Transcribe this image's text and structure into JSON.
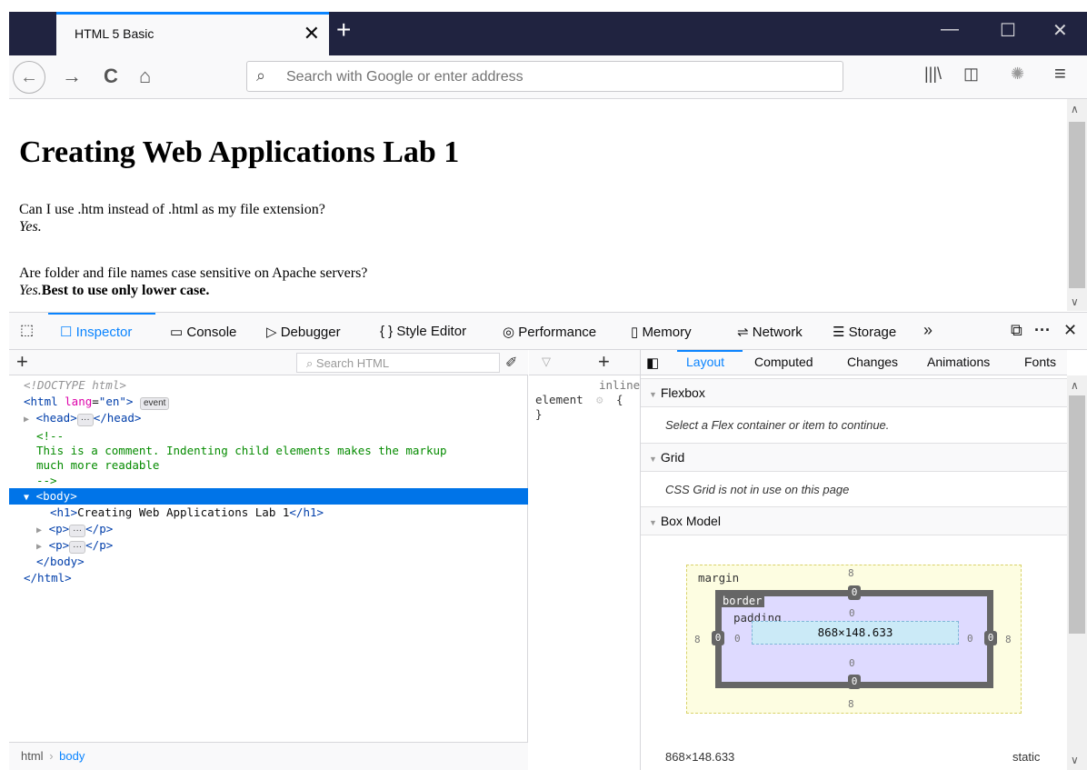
{
  "browser": {
    "tab_title": "HTML 5 Basic",
    "tab_close": "✕",
    "new_tab": "+",
    "window_controls": {
      "minimize": "—",
      "maximize": "☐",
      "close": "✕"
    },
    "nav": {
      "back": "←",
      "forward": "→",
      "reload": "C",
      "home": "⌂"
    },
    "url_placeholder": "Search with Google or enter address",
    "toolbar_icons": [
      "library-icon",
      "sidebar-icon",
      "addon-icon",
      "menu-icon"
    ],
    "library": "|||\\",
    "sidebar": "◫",
    "addon": "✺",
    "menu": "≡"
  },
  "page": {
    "heading": "Creating Web Applications Lab 1",
    "q1": "Can I use .htm instead of .html as my file extension?",
    "a1": "Yes.",
    "q2": "Are folder and file names case sensitive on Apache servers?",
    "a2_em": "Yes.",
    "a2_strong": "Best to use only lower case."
  },
  "devtools": {
    "tabs": [
      {
        "label": "Inspector",
        "icon": "☐"
      },
      {
        "label": "Console",
        "icon": "▭"
      },
      {
        "label": "Debugger",
        "icon": "▷"
      },
      {
        "label": "Style Editor",
        "icon": "{ }"
      },
      {
        "label": "Performance",
        "icon": "◎"
      },
      {
        "label": "Memory",
        "icon": "▯"
      },
      {
        "label": "Network",
        "icon": "⇌"
      },
      {
        "label": "Storage",
        "icon": "☰"
      }
    ],
    "more_tabs": "»",
    "dock": "⧉",
    "overflow": "···",
    "close": "✕",
    "pick": "⬚",
    "search_html_placeholder": "Search HTML",
    "tree": {
      "doctype": "<!DOCTYPE html>",
      "html_open": "<html ",
      "lang_attr": "lang",
      "lang_val": "\"en\"",
      "html_close_bracket": ">",
      "event_badge": "event",
      "head": "<head>",
      "head_end": "</head>",
      "comment1": "<!--",
      "comment2": "This is a comment. Indenting child elements makes the markup",
      "comment3": "much more readable",
      "comment4": "-->",
      "body_open": "<body>",
      "h1_open": "<h1>",
      "h1_text": "Creating Web Applications Lab 1",
      "h1_close": "</h1>",
      "p_open": "<p>",
      "p_close": "</p>",
      "body_close": "</body>",
      "html_close": "</html>",
      "ellipsis": "···"
    },
    "breadcrumbs": [
      "html",
      "body"
    ],
    "breadcrumb_sep": "›",
    "rules": {
      "filter": "▽",
      "add": "+",
      "inline": "inline",
      "element": "element",
      "brace_open": "{",
      "brace_close": "}"
    },
    "side_tabs": [
      "Layout",
      "Computed",
      "Changes",
      "Animations",
      "Fonts"
    ],
    "flexbox": {
      "title": "Flexbox",
      "message": "Select a Flex container or item to continue."
    },
    "grid": {
      "title": "Grid",
      "message": "CSS Grid is not in use on this page"
    },
    "box_model": {
      "title": "Box Model",
      "margin_label": "margin",
      "border_label": "border",
      "padding_label": "padding",
      "margin": {
        "top": "8",
        "right": "8",
        "bottom": "8",
        "left": "8"
      },
      "border": {
        "top": "0",
        "right": "0",
        "bottom": "0",
        "left": "0"
      },
      "padding": {
        "top": "0",
        "right": "0",
        "bottom": "0",
        "left": "0"
      },
      "content": "868×148.633",
      "dimensions": "868×148.633",
      "position": "static"
    }
  }
}
